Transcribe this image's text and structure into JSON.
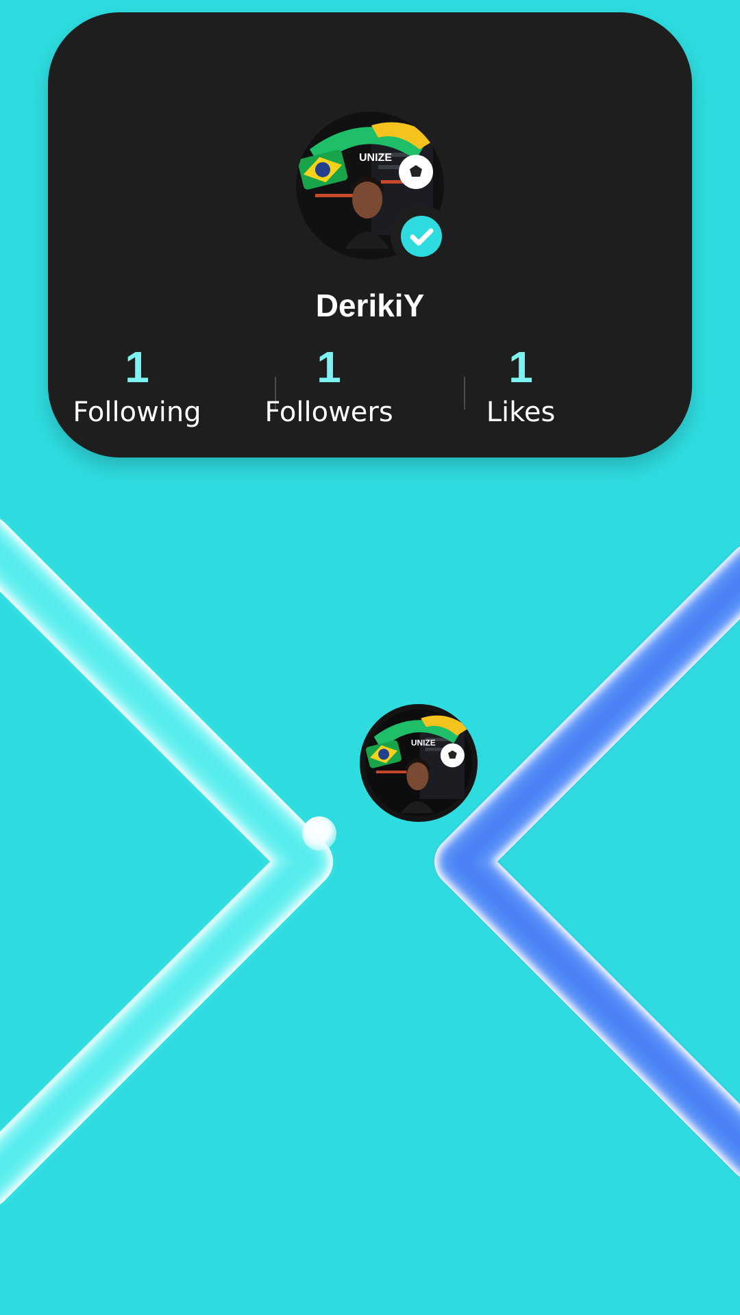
{
  "profile": {
    "username": "DerikiY",
    "avatar_icon": "profile-photo-avatar",
    "verified_icon": "verified-check-icon",
    "stats": [
      {
        "value": "1",
        "label": "Following"
      },
      {
        "value": "1",
        "label": "Followers"
      },
      {
        "value": "1",
        "label": "Likes"
      }
    ]
  },
  "game": {
    "left_paddle_color": "#6ff0f0",
    "right_paddle_color": "#5b92f7",
    "ball_icon": "ball",
    "center_avatar_icon": "profile-photo-avatar"
  },
  "colors": {
    "background": "#2edcdf",
    "card": "#1e1e1e",
    "stat_value": "#7cf3f2",
    "text": "#ffffff"
  }
}
